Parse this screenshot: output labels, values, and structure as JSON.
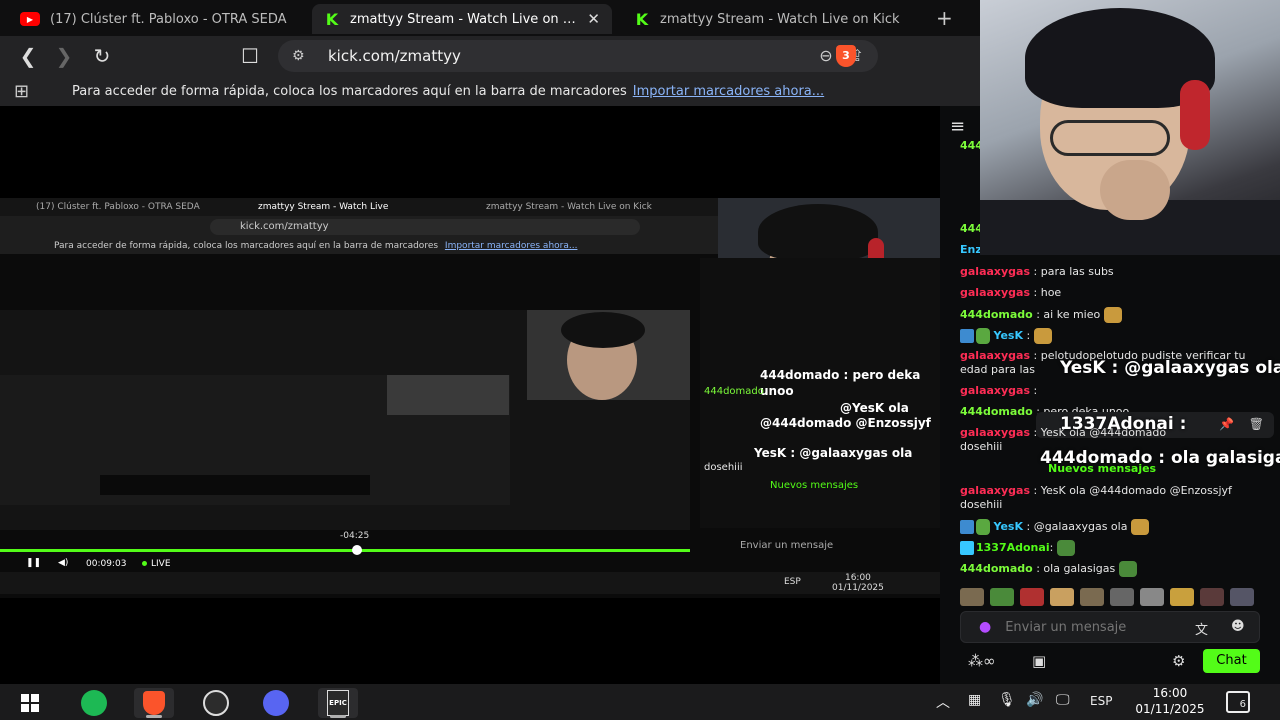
{
  "browser": {
    "tabs": [
      {
        "title": "(17) Clúster ft. Pabloxo - OTRA SEDA",
        "icon": "youtube-icon",
        "active": false
      },
      {
        "title": "zmattyy Stream - Watch Live on Kick",
        "icon": "kick-icon",
        "active": true
      },
      {
        "title": "zmattyy Stream - Watch Live on Kick",
        "icon": "kick-icon",
        "active": false
      }
    ],
    "close_glyph": "✕",
    "new_tab_glyph": "+",
    "url": "kick.com/zmattyy",
    "shield_count": "3",
    "bookmarks_hint": "Para acceder de forma rápida, coloca los marcadores aquí en la barra de marcadores",
    "bookmarks_import": "Importar marcadores ahora...",
    "accent_color": "#53fc18"
  },
  "nested_view": {
    "tabs": [
      "(17) Clúster ft. Pabloxo - OTRA SEDA",
      "zmattyy Stream - Watch Live",
      "zmattyy Stream - Watch Live on Kick"
    ],
    "url": "kick.com/zmattyy",
    "bookmarks_hint": "Para acceder de forma rápida, coloca los marcadores aquí en la barra de marcadores",
    "bookmarks_import": "Importar marcadores ahora...",
    "chat": [
      {
        "text": "444domado : pero deka",
        "big": true
      },
      {
        "text": "unoo",
        "big": true
      },
      {
        "text": "444domado",
        "big": false
      },
      {
        "text": "@YesK ola",
        "big": true
      },
      {
        "text": "@444domado @Enzossjyf",
        "big": true
      },
      {
        "text": "dosehiii",
        "big": false
      },
      {
        "text": "YesK : @galaaxygas ola",
        "big": true
      },
      {
        "text": "Nuevos mensajes",
        "big": false
      },
      {
        "text": "Enviar un mensaje",
        "big": false
      }
    ],
    "player": {
      "time_label": "-04:25",
      "elapsed": "00:09:03",
      "live": "LIVE",
      "progress_fraction": 0.51
    },
    "taskbar_clock": {
      "time": "16:00",
      "date": "01/11/2025",
      "lang": "ESP"
    }
  },
  "chat": {
    "messages": [
      {
        "user": "galaaxygas",
        "color": "red",
        "text": ": para las subs"
      },
      {
        "user": "galaaxygas",
        "color": "red",
        "text": ": hoe"
      },
      {
        "user": "444domado",
        "color": "green",
        "text": ": ai ke mieo"
      },
      {
        "user": "YesK",
        "color": "cyan",
        "text": ":"
      },
      {
        "user": "galaaxygas",
        "color": "red",
        "text": ": pelotudopelotudo pudiste verificar tu"
      },
      {
        "user": "",
        "color": "red",
        "text": "edad para las"
      },
      {
        "user": "galaaxygas",
        "color": "red",
        "text": ":"
      },
      {
        "user": "444domado",
        "color": "green",
        "text": ": pero deka unoo"
      },
      {
        "user": "galaaxygas",
        "color": "red",
        "text": ": YesK ola @444domado"
      },
      {
        "user": "",
        "color": "red",
        "text": "dosehiii"
      },
      {
        "user": "galaaxygas",
        "color": "red",
        "text": ": YesK ola @444domado @Enzossjyf"
      },
      {
        "user": "",
        "color": "red",
        "text": "dosehiii"
      },
      {
        "user": "YesK",
        "color": "cyan",
        "text": ": @galaaxygas ola"
      },
      {
        "user": "1337Adonai",
        "color": "lime",
        "text": ":"
      },
      {
        "user": "444domado",
        "color": "green",
        "text": ": ola galasigas"
      }
    ],
    "overlays": {
      "yesk": "YesK : @galaaxygas ola",
      "adonai": "1337Adonai :",
      "domado": "444domado : ola galasigas"
    },
    "new_messages": "Nuevos mensajes",
    "input_placeholder": "Enviar un mensaje",
    "send_label": "Chat",
    "collapse_glyph": "≡",
    "top_partial": [
      "444",
      "Enz"
    ]
  },
  "taskbar": {
    "apps": [
      "windows-start",
      "spotify",
      "brave",
      "obs",
      "discord",
      "epic-games"
    ],
    "epic_label": "EPIC",
    "lang": "ESP",
    "time": "16:00",
    "date": "01/11/2025",
    "notifications": "6"
  }
}
